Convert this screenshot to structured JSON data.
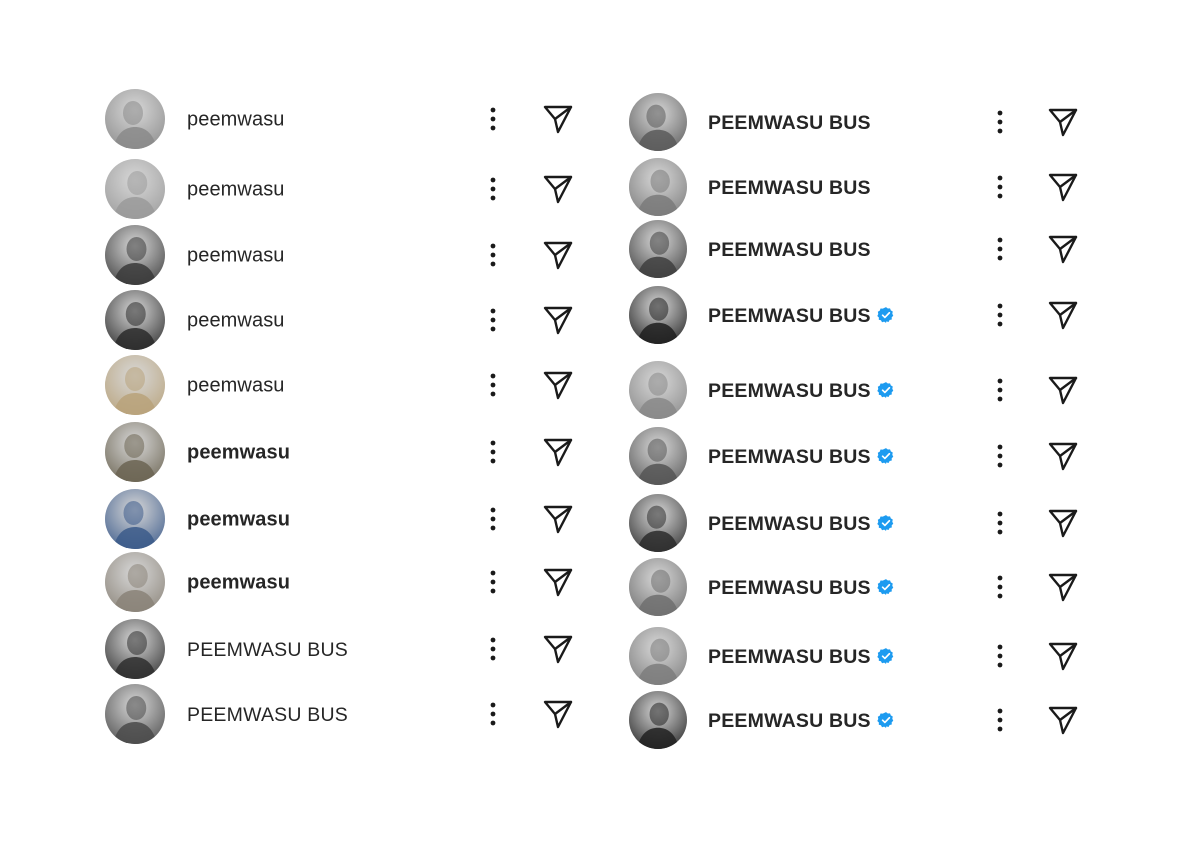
{
  "left_column": [
    {
      "name": "peemwasu",
      "verified": false,
      "weight": "normal",
      "avatar_tone": "#8a8a8a"
    },
    {
      "name": "peemwasu",
      "verified": false,
      "weight": "normal",
      "avatar_tone": "#9a9a9a"
    },
    {
      "name": "peemwasu",
      "verified": false,
      "weight": "normal",
      "avatar_tone": "#3a3a3a"
    },
    {
      "name": "peemwasu",
      "verified": false,
      "weight": "normal",
      "avatar_tone": "#2a2a2a"
    },
    {
      "name": "peemwasu",
      "verified": false,
      "weight": "normal",
      "avatar_tone": "#b8a27a"
    },
    {
      "name": "peemwasu",
      "verified": false,
      "weight": "bold",
      "avatar_tone": "#6b6452"
    },
    {
      "name": "peemwasu",
      "verified": false,
      "weight": "bold",
      "avatar_tone": "#3b5a8a"
    },
    {
      "name": "peemwasu",
      "verified": false,
      "weight": "bold",
      "avatar_tone": "#8a8378"
    },
    {
      "name": "PEEMWASU BUS",
      "verified": false,
      "weight": "normal",
      "avatar_tone": "#2e2e2e"
    },
    {
      "name": "PEEMWASU BUS",
      "verified": false,
      "weight": "normal",
      "avatar_tone": "#4a4a4a"
    }
  ],
  "right_column": [
    {
      "name": "PEEMWASU BUS",
      "verified": false,
      "weight": "bold",
      "avatar_tone": "#5a5a5a"
    },
    {
      "name": "PEEMWASU BUS",
      "verified": false,
      "weight": "bold",
      "avatar_tone": "#7a7a7a"
    },
    {
      "name": "PEEMWASU BUS",
      "verified": false,
      "weight": "bold",
      "avatar_tone": "#3e3e3e"
    },
    {
      "name": "PEEMWASU BUS",
      "verified": true,
      "weight": "bold",
      "avatar_tone": "#1e1e1e"
    },
    {
      "name": "PEEMWASU BUS",
      "verified": true,
      "weight": "bold",
      "avatar_tone": "#888888"
    },
    {
      "name": "PEEMWASU BUS",
      "verified": true,
      "weight": "bold",
      "avatar_tone": "#555555"
    },
    {
      "name": "PEEMWASU BUS",
      "verified": true,
      "weight": "bold",
      "avatar_tone": "#2c2c2c"
    },
    {
      "name": "PEEMWASU BUS",
      "verified": true,
      "weight": "bold",
      "avatar_tone": "#6e6e6e"
    },
    {
      "name": "PEEMWASU BUS",
      "verified": true,
      "weight": "bold",
      "avatar_tone": "#7c7c7c"
    },
    {
      "name": "PEEMWASU BUS",
      "verified": true,
      "weight": "bold",
      "avatar_tone": "#202020"
    }
  ],
  "icons": {
    "more": "more-vertical-icon",
    "send": "send-paper-plane-icon",
    "verified": "verified-badge-icon"
  },
  "colors": {
    "text": "#262626",
    "icon": "#1a1a1a",
    "verified": "#1d9bf0",
    "background": "#ffffff"
  }
}
